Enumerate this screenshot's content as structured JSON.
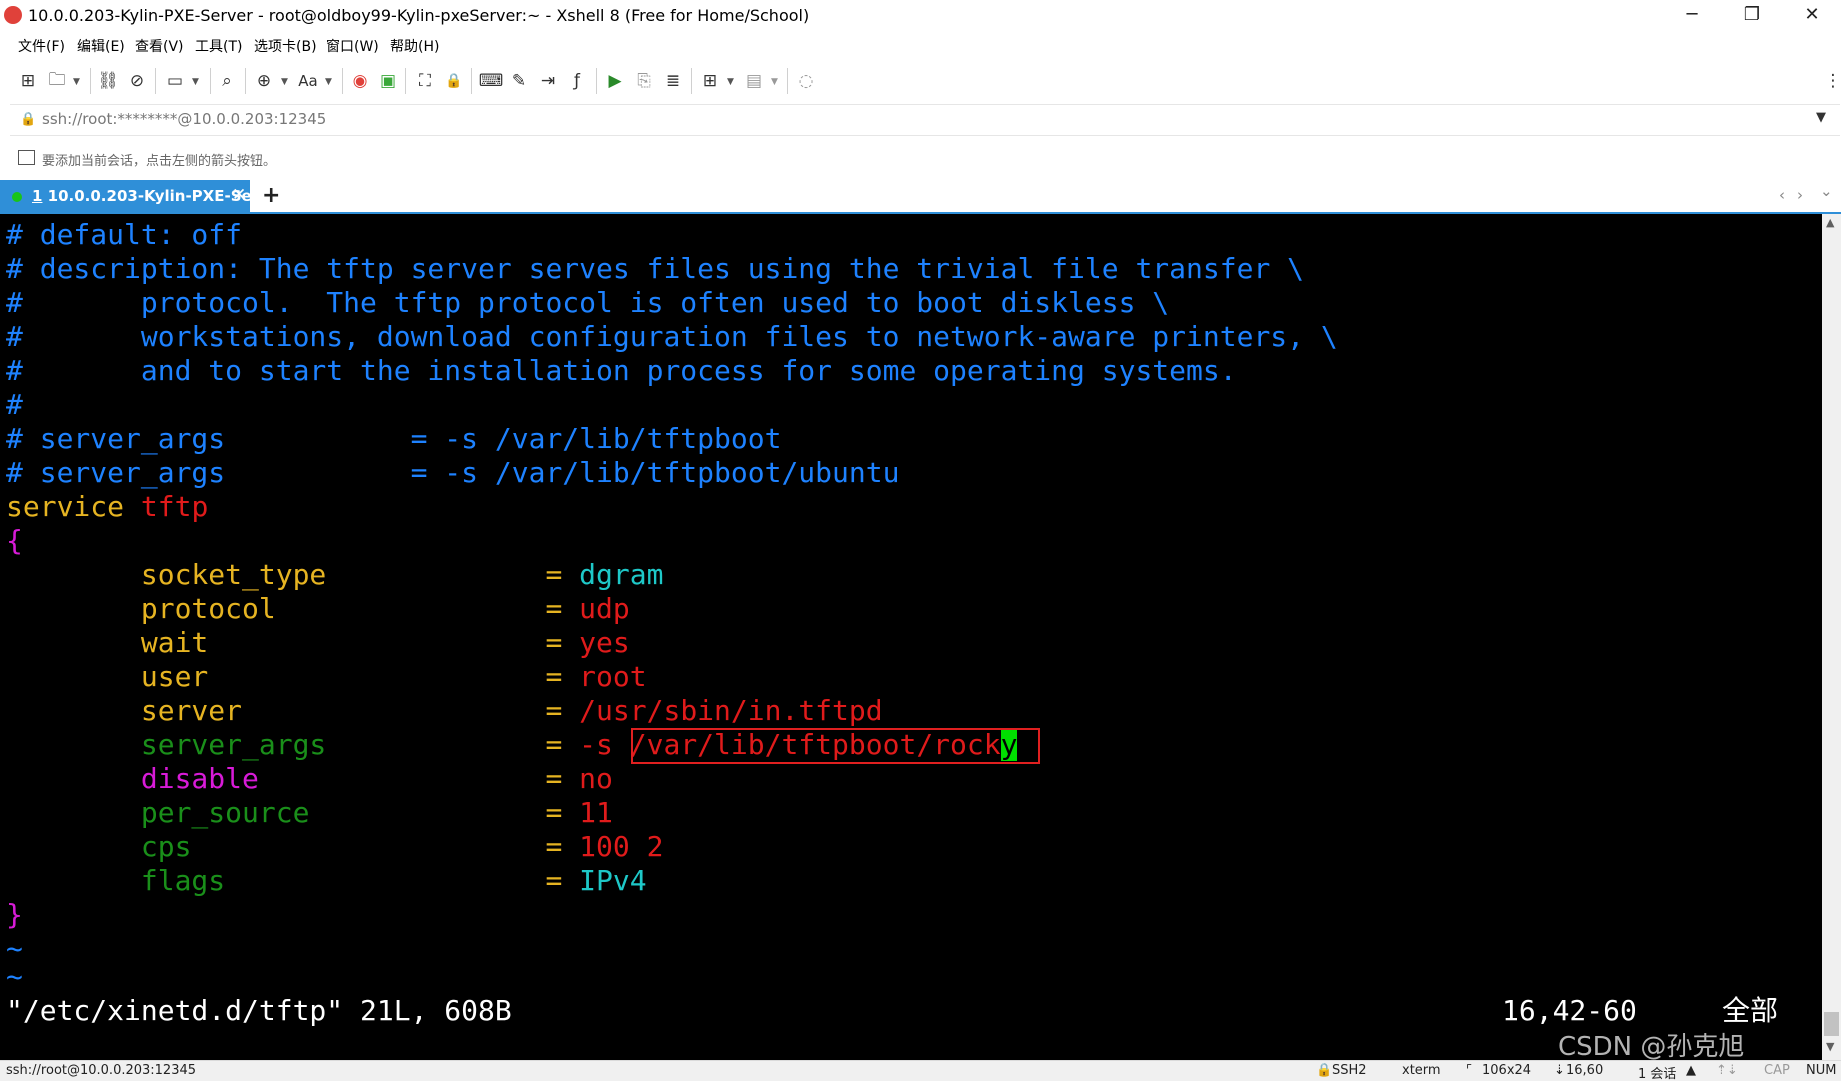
{
  "window": {
    "title": "10.0.0.203-Kylin-PXE-Server - root@oldboy99-Kylin-pxeServer:~ - Xshell 8 (Free for Home/School)",
    "minimize": "─",
    "restore": "❐",
    "close": "✕"
  },
  "menu": [
    "文件(F)",
    "编辑(E)",
    "查看(V)",
    "工具(T)",
    "选项卡(B)",
    "窗口(W)",
    "帮助(H)"
  ],
  "toolbar": {
    "new_session": "⊞",
    "open_folder": "🗀",
    "reconnect": "⛓",
    "disconnect": "⊘",
    "new_window": "▭",
    "search": "⌕",
    "globe": "⊕",
    "font": "Aa",
    "xftp": "◉",
    "xftp2": "▣",
    "fullscreen": "⛶",
    "lock": "🔒",
    "keyboard": "⌨",
    "compose": "✎",
    "send": "⇥",
    "script": "ƒ",
    "log": "▶",
    "copy": "⎘",
    "note": "≣",
    "add_tab": "⊞",
    "layout": "▤",
    "chat": "◌",
    "more": "⋮"
  },
  "address": {
    "lock": "🔒",
    "text": "ssh://root:********@10.0.0.203:12345",
    "dropdown": "▼"
  },
  "hint": {
    "text": "要添加当前会话，点击左侧的箭头按钮。"
  },
  "tab": {
    "number": "1",
    "label": " 10.0.0.203-Kylin-PXE-Se...",
    "close": "✕",
    "add": "+",
    "prev": "‹",
    "next": "›",
    "menu": "⌄"
  },
  "terminal": {
    "comment_lines": [
      "# default: off",
      "# description: The tftp server serves files using the trivial file transfer \\",
      "#       protocol.  The tftp protocol is often used to boot diskless \\",
      "#       workstations, download configuration files to network-aware printers, \\",
      "#       and to start the installation process for some operating systems.",
      "#",
      "# server_args           = -s /var/lib/tftpboot",
      "# server_args           = -s /var/lib/tftpboot/ubuntu"
    ],
    "service_keyword": "service",
    "service_name": " tftp",
    "open_brace": "{",
    "settings": [
      {
        "indent": "        ",
        "key": "socket_type",
        "pad": "             ",
        "eq": "= ",
        "value": "dgram"
      },
      {
        "indent": "        ",
        "key": "protocol",
        "pad": "                ",
        "eq": "= ",
        "value": "udp"
      },
      {
        "indent": "        ",
        "key": "wait",
        "pad": "                    ",
        "eq": "= ",
        "value": "yes"
      },
      {
        "indent": "        ",
        "key": "user",
        "pad": "                    ",
        "eq": "= ",
        "value": "root"
      },
      {
        "indent": "        ",
        "key": "server",
        "pad": "                  ",
        "eq": "= ",
        "value": "/usr/sbin/in.tftpd"
      },
      {
        "indent": "        ",
        "key": "server_args",
        "pad": "             ",
        "eq": "= ",
        "value_prefix": "-s ",
        "value": "/var/lib/tftpboot/rock",
        "cursor_char": "y"
      },
      {
        "indent": "        ",
        "key": "disable",
        "pad": "                 ",
        "eq": "= ",
        "value": "no"
      },
      {
        "indent": "        ",
        "key": "per_source",
        "pad": "              ",
        "eq": "= ",
        "value": "11"
      },
      {
        "indent": "        ",
        "key": "cps",
        "pad": "                     ",
        "eq": "= ",
        "value": "100 2"
      },
      {
        "indent": "        ",
        "key": "flags",
        "pad": "                   ",
        "eq": "= ",
        "value": "IPv4"
      }
    ],
    "close_brace": "}",
    "tilde_1": "~",
    "tilde_2": "~",
    "status_file": "\"/etc/xinetd.d/tftp\" 21L, 608B",
    "status_pos": "16,42-60",
    "status_all": "全部",
    "colors": {
      "comment": "#1e82ff",
      "keyword": "#e6b422",
      "string": "#e01b1b",
      "brace": "#d81bd8",
      "type": "#1ec8c8",
      "dim": "#1a8f1a",
      "cursor": "#00e000",
      "annotation_box": "#e02020"
    }
  },
  "watermark": "CSDN @孙克旭",
  "statusbar": {
    "connection": "ssh://root@10.0.0.203:12345",
    "protocol": "SSH2",
    "terminal_type": "xterm",
    "size": "106x24",
    "cursor_pos": "16,60",
    "sessions": "1 会话",
    "cap": "CAP",
    "num": "NUM"
  }
}
